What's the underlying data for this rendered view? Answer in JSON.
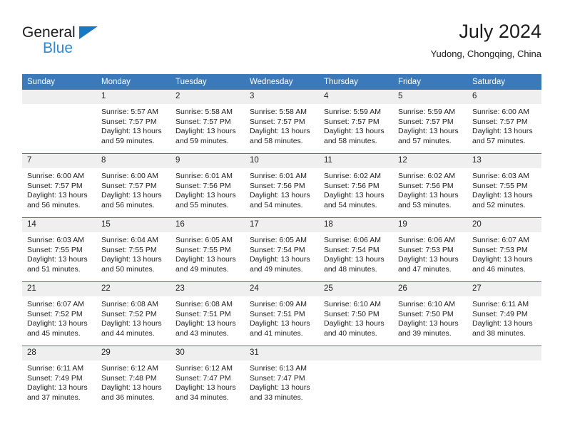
{
  "brand": {
    "name_top": "General",
    "name_bottom": "Blue",
    "accent_color": "#2e8ad4",
    "triangle_color": "#1878c4"
  },
  "header": {
    "title": "July 2024",
    "subtitle": "Yudong, Chongqing, China"
  },
  "theme": {
    "header_row_bg": "#3a79ba",
    "daynum_bg": "#efefef",
    "text_color": "#222222"
  },
  "weekday_headers": [
    "Sunday",
    "Monday",
    "Tuesday",
    "Wednesday",
    "Thursday",
    "Friday",
    "Saturday"
  ],
  "weeks": [
    [
      {
        "day": "",
        "blank": true,
        "sunrise": "",
        "sunset": "",
        "daylight_1": "",
        "daylight_2": ""
      },
      {
        "day": "1",
        "sunrise": "Sunrise: 5:57 AM",
        "sunset": "Sunset: 7:57 PM",
        "daylight_1": "Daylight: 13 hours",
        "daylight_2": "and 59 minutes."
      },
      {
        "day": "2",
        "sunrise": "Sunrise: 5:58 AM",
        "sunset": "Sunset: 7:57 PM",
        "daylight_1": "Daylight: 13 hours",
        "daylight_2": "and 59 minutes."
      },
      {
        "day": "3",
        "sunrise": "Sunrise: 5:58 AM",
        "sunset": "Sunset: 7:57 PM",
        "daylight_1": "Daylight: 13 hours",
        "daylight_2": "and 58 minutes."
      },
      {
        "day": "4",
        "sunrise": "Sunrise: 5:59 AM",
        "sunset": "Sunset: 7:57 PM",
        "daylight_1": "Daylight: 13 hours",
        "daylight_2": "and 58 minutes."
      },
      {
        "day": "5",
        "sunrise": "Sunrise: 5:59 AM",
        "sunset": "Sunset: 7:57 PM",
        "daylight_1": "Daylight: 13 hours",
        "daylight_2": "and 57 minutes."
      },
      {
        "day": "6",
        "sunrise": "Sunrise: 6:00 AM",
        "sunset": "Sunset: 7:57 PM",
        "daylight_1": "Daylight: 13 hours",
        "daylight_2": "and 57 minutes."
      }
    ],
    [
      {
        "day": "7",
        "sunrise": "Sunrise: 6:00 AM",
        "sunset": "Sunset: 7:57 PM",
        "daylight_1": "Daylight: 13 hours",
        "daylight_2": "and 56 minutes."
      },
      {
        "day": "8",
        "sunrise": "Sunrise: 6:00 AM",
        "sunset": "Sunset: 7:57 PM",
        "daylight_1": "Daylight: 13 hours",
        "daylight_2": "and 56 minutes."
      },
      {
        "day": "9",
        "sunrise": "Sunrise: 6:01 AM",
        "sunset": "Sunset: 7:56 PM",
        "daylight_1": "Daylight: 13 hours",
        "daylight_2": "and 55 minutes."
      },
      {
        "day": "10",
        "sunrise": "Sunrise: 6:01 AM",
        "sunset": "Sunset: 7:56 PM",
        "daylight_1": "Daylight: 13 hours",
        "daylight_2": "and 54 minutes."
      },
      {
        "day": "11",
        "sunrise": "Sunrise: 6:02 AM",
        "sunset": "Sunset: 7:56 PM",
        "daylight_1": "Daylight: 13 hours",
        "daylight_2": "and 54 minutes."
      },
      {
        "day": "12",
        "sunrise": "Sunrise: 6:02 AM",
        "sunset": "Sunset: 7:56 PM",
        "daylight_1": "Daylight: 13 hours",
        "daylight_2": "and 53 minutes."
      },
      {
        "day": "13",
        "sunrise": "Sunrise: 6:03 AM",
        "sunset": "Sunset: 7:55 PM",
        "daylight_1": "Daylight: 13 hours",
        "daylight_2": "and 52 minutes."
      }
    ],
    [
      {
        "day": "14",
        "sunrise": "Sunrise: 6:03 AM",
        "sunset": "Sunset: 7:55 PM",
        "daylight_1": "Daylight: 13 hours",
        "daylight_2": "and 51 minutes."
      },
      {
        "day": "15",
        "sunrise": "Sunrise: 6:04 AM",
        "sunset": "Sunset: 7:55 PM",
        "daylight_1": "Daylight: 13 hours",
        "daylight_2": "and 50 minutes."
      },
      {
        "day": "16",
        "sunrise": "Sunrise: 6:05 AM",
        "sunset": "Sunset: 7:55 PM",
        "daylight_1": "Daylight: 13 hours",
        "daylight_2": "and 49 minutes."
      },
      {
        "day": "17",
        "sunrise": "Sunrise: 6:05 AM",
        "sunset": "Sunset: 7:54 PM",
        "daylight_1": "Daylight: 13 hours",
        "daylight_2": "and 49 minutes."
      },
      {
        "day": "18",
        "sunrise": "Sunrise: 6:06 AM",
        "sunset": "Sunset: 7:54 PM",
        "daylight_1": "Daylight: 13 hours",
        "daylight_2": "and 48 minutes."
      },
      {
        "day": "19",
        "sunrise": "Sunrise: 6:06 AM",
        "sunset": "Sunset: 7:53 PM",
        "daylight_1": "Daylight: 13 hours",
        "daylight_2": "and 47 minutes."
      },
      {
        "day": "20",
        "sunrise": "Sunrise: 6:07 AM",
        "sunset": "Sunset: 7:53 PM",
        "daylight_1": "Daylight: 13 hours",
        "daylight_2": "and 46 minutes."
      }
    ],
    [
      {
        "day": "21",
        "sunrise": "Sunrise: 6:07 AM",
        "sunset": "Sunset: 7:52 PM",
        "daylight_1": "Daylight: 13 hours",
        "daylight_2": "and 45 minutes."
      },
      {
        "day": "22",
        "sunrise": "Sunrise: 6:08 AM",
        "sunset": "Sunset: 7:52 PM",
        "daylight_1": "Daylight: 13 hours",
        "daylight_2": "and 44 minutes."
      },
      {
        "day": "23",
        "sunrise": "Sunrise: 6:08 AM",
        "sunset": "Sunset: 7:51 PM",
        "daylight_1": "Daylight: 13 hours",
        "daylight_2": "and 43 minutes."
      },
      {
        "day": "24",
        "sunrise": "Sunrise: 6:09 AM",
        "sunset": "Sunset: 7:51 PM",
        "daylight_1": "Daylight: 13 hours",
        "daylight_2": "and 41 minutes."
      },
      {
        "day": "25",
        "sunrise": "Sunrise: 6:10 AM",
        "sunset": "Sunset: 7:50 PM",
        "daylight_1": "Daylight: 13 hours",
        "daylight_2": "and 40 minutes."
      },
      {
        "day": "26",
        "sunrise": "Sunrise: 6:10 AM",
        "sunset": "Sunset: 7:50 PM",
        "daylight_1": "Daylight: 13 hours",
        "daylight_2": "and 39 minutes."
      },
      {
        "day": "27",
        "sunrise": "Sunrise: 6:11 AM",
        "sunset": "Sunset: 7:49 PM",
        "daylight_1": "Daylight: 13 hours",
        "daylight_2": "and 38 minutes."
      }
    ],
    [
      {
        "day": "28",
        "sunrise": "Sunrise: 6:11 AM",
        "sunset": "Sunset: 7:49 PM",
        "daylight_1": "Daylight: 13 hours",
        "daylight_2": "and 37 minutes."
      },
      {
        "day": "29",
        "sunrise": "Sunrise: 6:12 AM",
        "sunset": "Sunset: 7:48 PM",
        "daylight_1": "Daylight: 13 hours",
        "daylight_2": "and 36 minutes."
      },
      {
        "day": "30",
        "sunrise": "Sunrise: 6:12 AM",
        "sunset": "Sunset: 7:47 PM",
        "daylight_1": "Daylight: 13 hours",
        "daylight_2": "and 34 minutes."
      },
      {
        "day": "31",
        "sunrise": "Sunrise: 6:13 AM",
        "sunset": "Sunset: 7:47 PM",
        "daylight_1": "Daylight: 13 hours",
        "daylight_2": "and 33 minutes."
      },
      {
        "day": "",
        "blank": true,
        "sunrise": "",
        "sunset": "",
        "daylight_1": "",
        "daylight_2": ""
      },
      {
        "day": "",
        "blank": true,
        "sunrise": "",
        "sunset": "",
        "daylight_1": "",
        "daylight_2": ""
      },
      {
        "day": "",
        "blank": true,
        "sunrise": "",
        "sunset": "",
        "daylight_1": "",
        "daylight_2": ""
      }
    ]
  ]
}
